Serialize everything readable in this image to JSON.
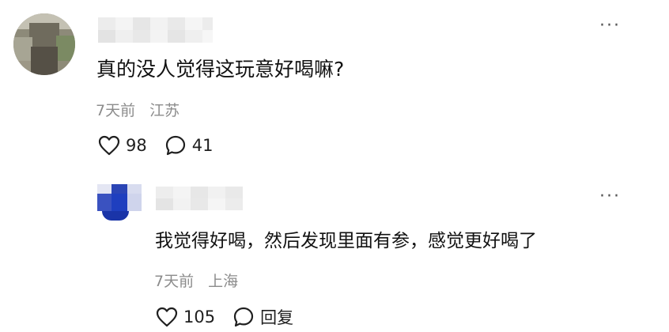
{
  "comment": {
    "text": "真的没人觉得这玩意好喝嘛?",
    "time": "7天前",
    "location": "江苏",
    "likes": "98",
    "replies": "41",
    "more_icon": "more-horizontal-icon"
  },
  "reply": {
    "text": "我觉得好喝，然后发现里面有参，感觉更好喝了",
    "time": "7天前",
    "location": "上海",
    "likes": "105",
    "reply_label": "回复",
    "more_icon": "more-horizontal-icon"
  },
  "icons": {
    "like": "heart-outline-icon",
    "comment": "speech-bubble-icon"
  },
  "colors": {
    "meta_text": "#8c8c8c",
    "body_text": "#111111",
    "reply_avatar_blue": "#1f3fbf"
  }
}
